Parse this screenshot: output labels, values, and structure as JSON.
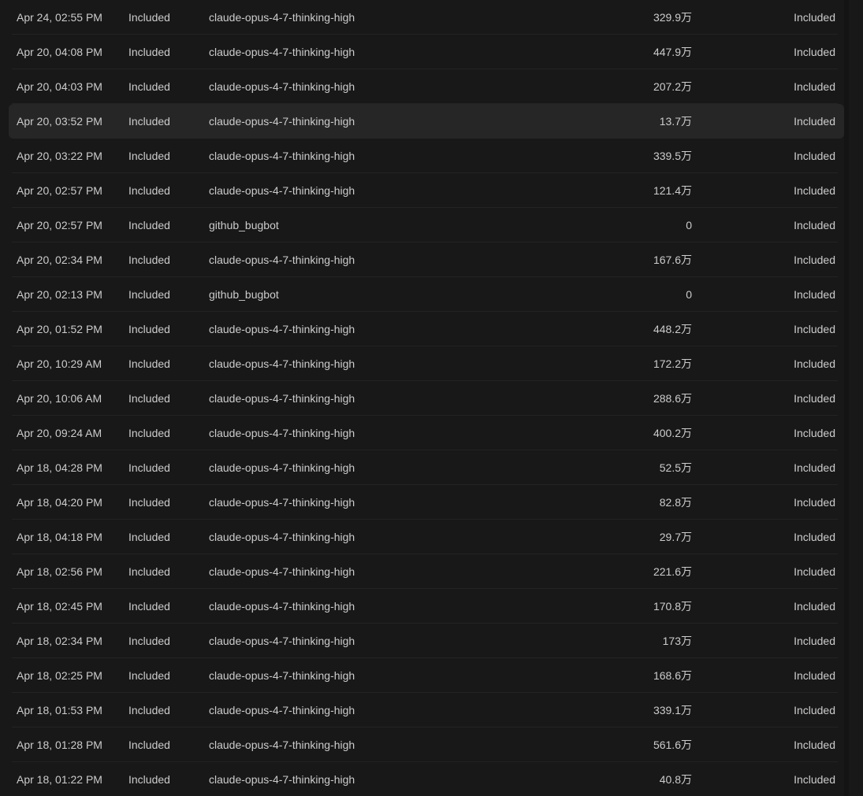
{
  "rows": [
    {
      "date": "Apr 24, 02:55 PM",
      "kind": "Included",
      "model": "claude-opus-4-7-thinking-high",
      "tokens": "329.9万",
      "cost": "Included"
    },
    {
      "date": "Apr 20, 04:08 PM",
      "kind": "Included",
      "model": "claude-opus-4-7-thinking-high",
      "tokens": "447.9万",
      "cost": "Included"
    },
    {
      "date": "Apr 20, 04:03 PM",
      "kind": "Included",
      "model": "claude-opus-4-7-thinking-high",
      "tokens": "207.2万",
      "cost": "Included"
    },
    {
      "date": "Apr 20, 03:52 PM",
      "kind": "Included",
      "model": "claude-opus-4-7-thinking-high",
      "tokens": "13.7万",
      "cost": "Included"
    },
    {
      "date": "Apr 20, 03:22 PM",
      "kind": "Included",
      "model": "claude-opus-4-7-thinking-high",
      "tokens": "339.5万",
      "cost": "Included"
    },
    {
      "date": "Apr 20, 02:57 PM",
      "kind": "Included",
      "model": "claude-opus-4-7-thinking-high",
      "tokens": "121.4万",
      "cost": "Included"
    },
    {
      "date": "Apr 20, 02:57 PM",
      "kind": "Included",
      "model": "github_bugbot",
      "tokens": "0",
      "cost": "Included"
    },
    {
      "date": "Apr 20, 02:34 PM",
      "kind": "Included",
      "model": "claude-opus-4-7-thinking-high",
      "tokens": "167.6万",
      "cost": "Included"
    },
    {
      "date": "Apr 20, 02:13 PM",
      "kind": "Included",
      "model": "github_bugbot",
      "tokens": "0",
      "cost": "Included"
    },
    {
      "date": "Apr 20, 01:52 PM",
      "kind": "Included",
      "model": "claude-opus-4-7-thinking-high",
      "tokens": "448.2万",
      "cost": "Included"
    },
    {
      "date": "Apr 20, 10:29 AM",
      "kind": "Included",
      "model": "claude-opus-4-7-thinking-high",
      "tokens": "172.2万",
      "cost": "Included"
    },
    {
      "date": "Apr 20, 10:06 AM",
      "kind": "Included",
      "model": "claude-opus-4-7-thinking-high",
      "tokens": "288.6万",
      "cost": "Included"
    },
    {
      "date": "Apr 20, 09:24 AM",
      "kind": "Included",
      "model": "claude-opus-4-7-thinking-high",
      "tokens": "400.2万",
      "cost": "Included"
    },
    {
      "date": "Apr 18, 04:28 PM",
      "kind": "Included",
      "model": "claude-opus-4-7-thinking-high",
      "tokens": "52.5万",
      "cost": "Included"
    },
    {
      "date": "Apr 18, 04:20 PM",
      "kind": "Included",
      "model": "claude-opus-4-7-thinking-high",
      "tokens": "82.8万",
      "cost": "Included"
    },
    {
      "date": "Apr 18, 04:18 PM",
      "kind": "Included",
      "model": "claude-opus-4-7-thinking-high",
      "tokens": "29.7万",
      "cost": "Included"
    },
    {
      "date": "Apr 18, 02:56 PM",
      "kind": "Included",
      "model": "claude-opus-4-7-thinking-high",
      "tokens": "221.6万",
      "cost": "Included"
    },
    {
      "date": "Apr 18, 02:45 PM",
      "kind": "Included",
      "model": "claude-opus-4-7-thinking-high",
      "tokens": "170.8万",
      "cost": "Included"
    },
    {
      "date": "Apr 18, 02:34 PM",
      "kind": "Included",
      "model": "claude-opus-4-7-thinking-high",
      "tokens": "173万",
      "cost": "Included"
    },
    {
      "date": "Apr 18, 02:25 PM",
      "kind": "Included",
      "model": "claude-opus-4-7-thinking-high",
      "tokens": "168.6万",
      "cost": "Included"
    },
    {
      "date": "Apr 18, 01:53 PM",
      "kind": "Included",
      "model": "claude-opus-4-7-thinking-high",
      "tokens": "339.1万",
      "cost": "Included"
    },
    {
      "date": "Apr 18, 01:28 PM",
      "kind": "Included",
      "model": "claude-opus-4-7-thinking-high",
      "tokens": "561.6万",
      "cost": "Included"
    },
    {
      "date": "Apr 18, 01:22 PM",
      "kind": "Included",
      "model": "claude-opus-4-7-thinking-high",
      "tokens": "40.8万",
      "cost": "Included"
    }
  ],
  "highlighted_row": 3,
  "colors": {
    "background": "#181818",
    "row_hover": "#262626",
    "divider": "#232323",
    "text": "#cccccc"
  }
}
